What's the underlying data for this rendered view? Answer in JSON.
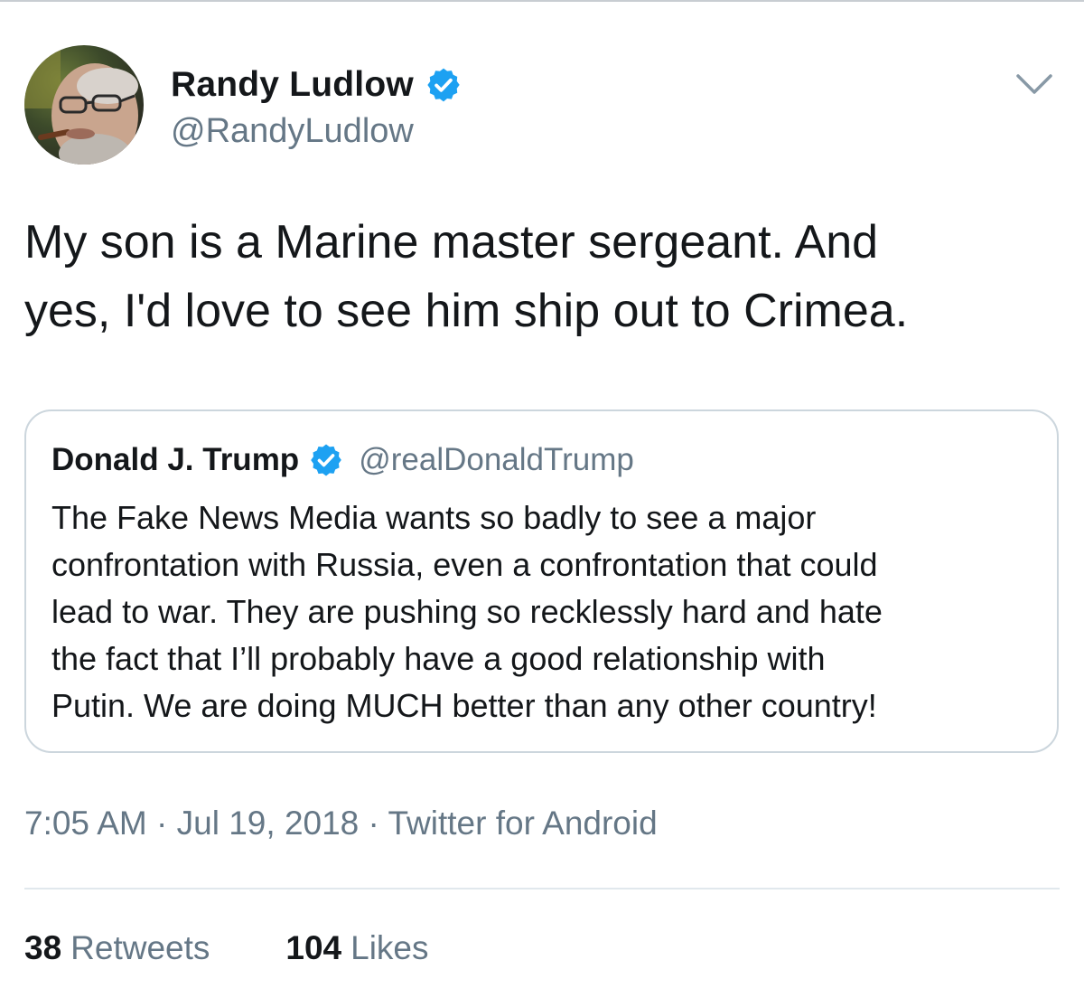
{
  "colors": {
    "verified_badge": "#1da1f2",
    "secondary_text": "#657786",
    "primary_text": "#14171a",
    "border": "#ccd6dd"
  },
  "tweet": {
    "author": {
      "display_name": "Randy Ludlow",
      "handle": "@RandyLudlow",
      "verified_icon": "verified-badge-icon",
      "avatar": "avatar-photo"
    },
    "menu_icon": "chevron-down-icon",
    "text": "My son is a Marine master sergeant. And\nyes, I'd love to see him ship out to Crimea.",
    "quoted": {
      "display_name": "Donald J. Trump",
      "handle": "@realDonaldTrump",
      "verified_icon": "verified-badge-icon",
      "text": "The Fake News Media wants so badly to see a major\nconfrontation with Russia, even a confrontation that could\nlead to war. They are pushing so recklessly hard and hate\nthe fact that I’ll probably have a good relationship with\nPutin. We are doing MUCH better than any other country!"
    },
    "meta": {
      "time": "7:05 AM",
      "separator": " · ",
      "date": "Jul 19, 2018",
      "source": "Twitter for Android"
    },
    "stats": {
      "retweets_count": "38",
      "retweets_label": "Retweets",
      "likes_count": "104",
      "likes_label": "Likes"
    }
  }
}
